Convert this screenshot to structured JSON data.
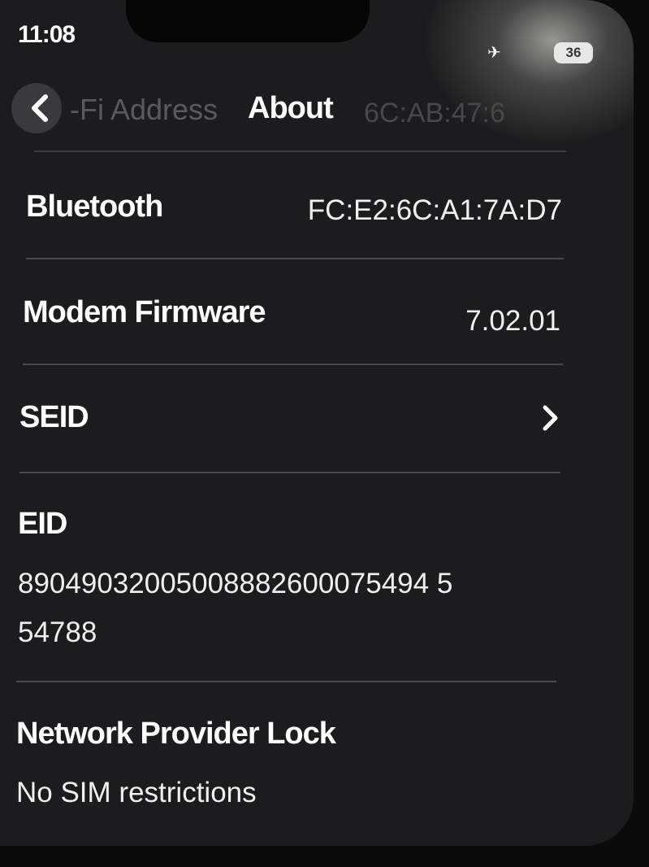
{
  "status_bar": {
    "time": "11:08",
    "battery": "36"
  },
  "nav": {
    "back_ghost_left": "-Fi Address",
    "back_ghost_right": "6C:AB:47:6",
    "title": "About"
  },
  "rows": {
    "bluetooth": {
      "label": "Bluetooth",
      "value": "FC:E2:6C:A1:7A:D7"
    },
    "modem_firmware": {
      "label": "Modem Firmware",
      "value": "7.02.01"
    },
    "seid": {
      "label": "SEID"
    },
    "eid": {
      "label": "EID",
      "value_line1": "89049032005008882600075494 5",
      "value_line2": "54788"
    },
    "network_provider_lock": {
      "label": "Network Provider Lock",
      "value": "No SIM restrictions"
    }
  },
  "colors": {
    "background": "#1c1c1e",
    "text": "#ffffff",
    "separator": "#4a4a4e"
  }
}
